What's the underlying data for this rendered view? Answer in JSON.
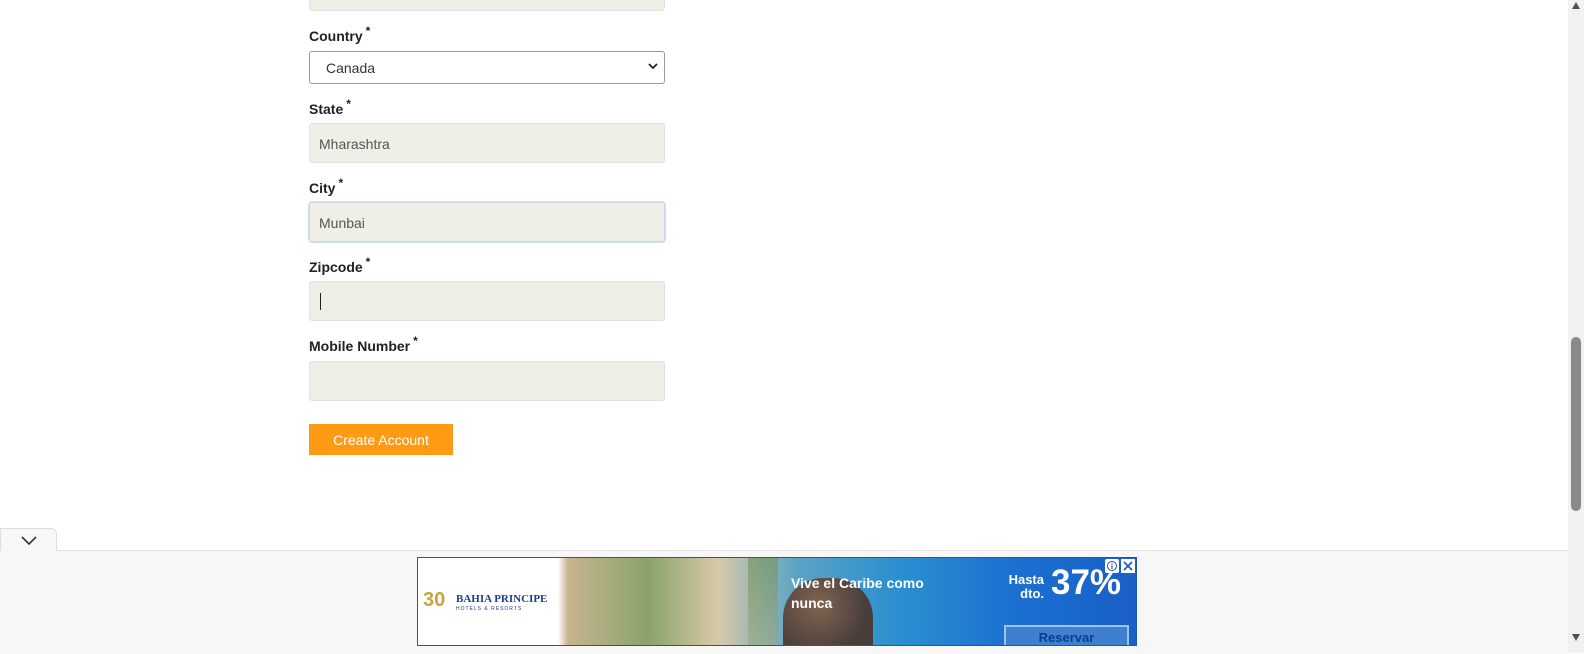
{
  "form": {
    "required_mark": "*",
    "country": {
      "label": "Country",
      "value": "Canada"
    },
    "state": {
      "label": "State",
      "value": "Mharashtra"
    },
    "city": {
      "label": "City",
      "value": "Munbai"
    },
    "zipcode": {
      "label": "Zipcode",
      "value": ""
    },
    "mobile": {
      "label": "Mobile Number",
      "value": ""
    },
    "submit_label": "Create Account"
  },
  "ad": {
    "brand": "BAHIA PRINCIPE",
    "brand_sub": "HOTELS & RESORTS",
    "brand_mark": "30",
    "headline": "Vive el Caribe como nunca",
    "discount_prefix": "Hasta dto.",
    "discount_value": "37%",
    "cta_label": "Reservar"
  }
}
